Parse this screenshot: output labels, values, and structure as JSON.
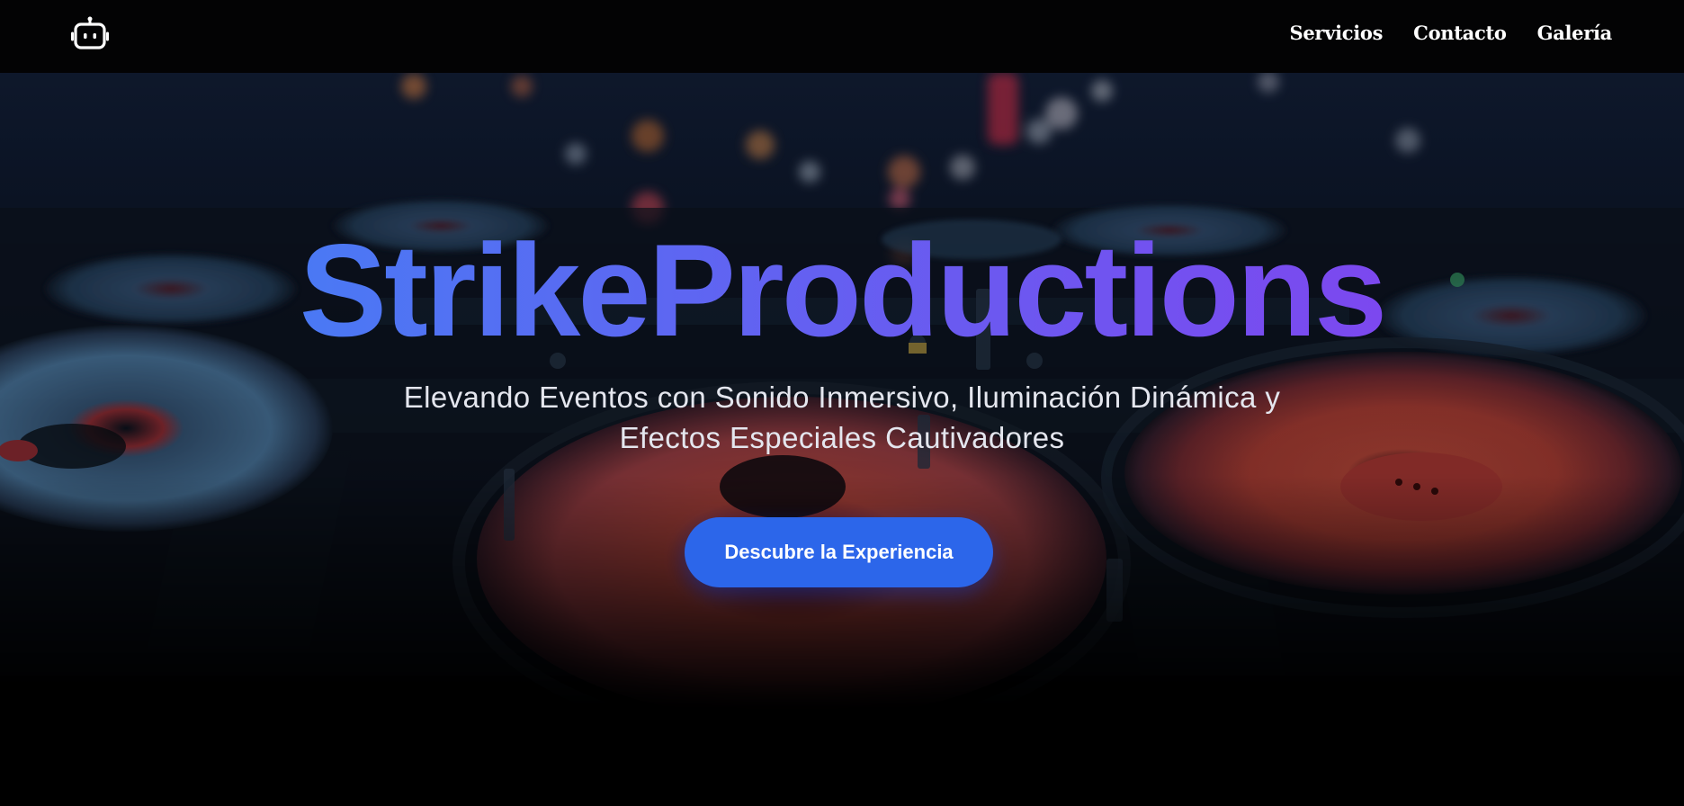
{
  "nav": {
    "logo_icon": "robot-icon",
    "links": [
      "Servicios",
      "Contacto",
      "Galería"
    ]
  },
  "hero": {
    "background": "dj-turntables-photo",
    "title": "StrikeProductions",
    "subtitle": "Elevando Eventos con Sonido Inmersivo, Iluminación Dinámica y Efectos Especiales Cautivadores",
    "cta_label": "Descubre la Experiencia"
  },
  "colors": {
    "nav_background": "#030304",
    "title_gradient_start": "#4a79f4",
    "title_gradient_end": "#7c48ef",
    "cta_background": "#2c66ea",
    "subtitle_text": "#e4e6ee"
  }
}
